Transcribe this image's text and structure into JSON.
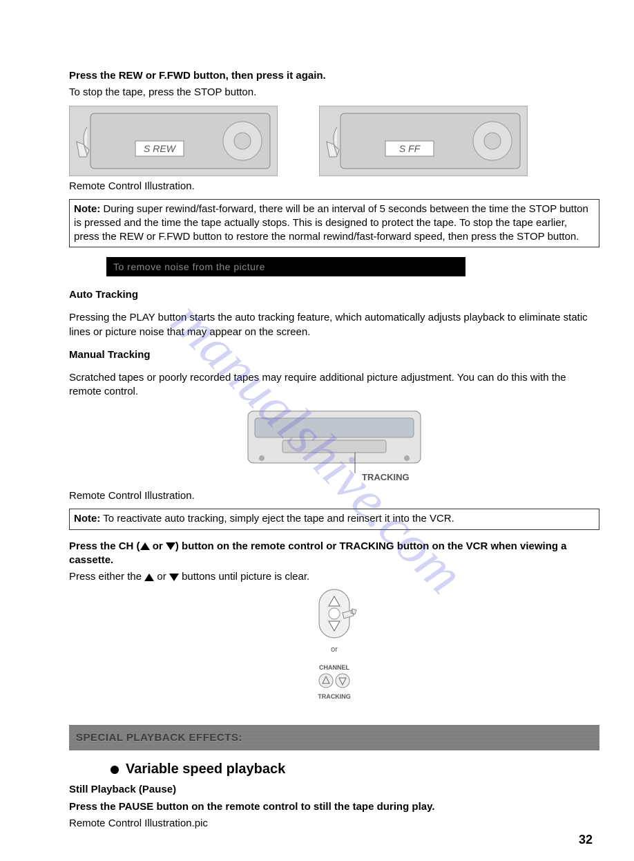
{
  "watermark": "manualshive.com",
  "intro": {
    "line1_bold": "Press the REW or F.FWD button, then press it again.",
    "line2": "To stop the tape, press the STOP button."
  },
  "illus1_left_label": "S REW",
  "illus1_right_label": "S FF",
  "caption1": "Remote Control Illustration.",
  "note1": {
    "label": "Note:",
    "text": " During super rewind/fast-forward, there will be an interval of 5 seconds between the time the STOP button is pressed and the time the tape actually stops. This is designed to protect the tape. To stop the tape earlier, press the REW or F.FWD button to restore the normal rewind/fast-forward speed, then press the STOP button."
  },
  "black_bar": "To remove noise from the picture",
  "auto_tracking": {
    "title": "Auto Tracking",
    "text": "Pressing the PLAY button starts the auto tracking feature, which automatically adjusts playback to eliminate static lines or picture noise that may appear on the screen."
  },
  "manual_tracking": {
    "title": "Manual Tracking",
    "text": "Scratched tapes or poorly recorded tapes may require additional picture adjustment. You can do this with the remote control."
  },
  "vcr_label": "TRACKING",
  "caption2": "Remote Control Illustration.",
  "note2": {
    "label": "Note:",
    "text": " To reactivate auto tracking, simply eject the tape and reinsert it into the VCR."
  },
  "ch_instruction": {
    "pre": "Press the CH (",
    "mid": " or ",
    "post": ") button on the remote control or TRACKING button on the VCR when viewing a cassette."
  },
  "press_either": {
    "pre": "Press either the ",
    "mid": " or ",
    "post": " buttons until picture is clear."
  },
  "remote_labels": {
    "or": "or",
    "channel": "CHANNEL",
    "tracking": "TRACKING"
  },
  "gray_bar": "SPECIAL PLAYBACK EFFECTS:",
  "variable_title": "Variable speed playback",
  "still": {
    "title": "Still Playback (Pause)",
    "instr": "Press the PAUSE button on the remote control to still the tape during play.",
    "caption": "Remote Control Illustration.pic"
  },
  "page_number": "32"
}
